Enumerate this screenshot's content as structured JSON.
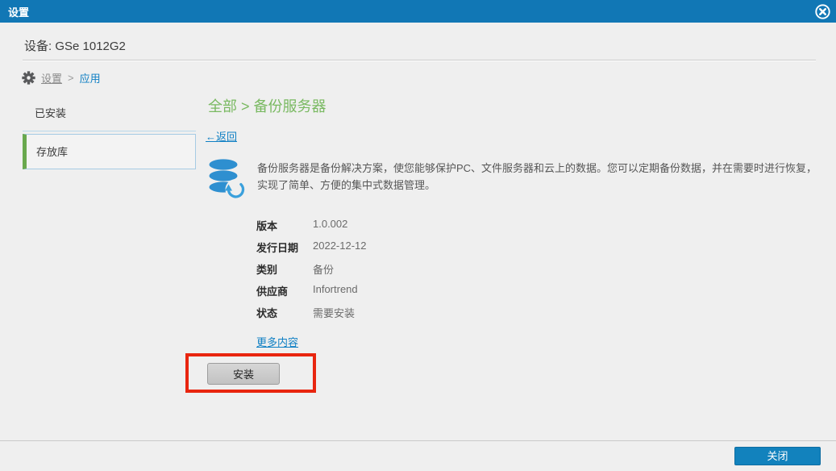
{
  "titlebar": {
    "title": "设置"
  },
  "device": {
    "title": "设备: GSe 1012G2"
  },
  "breadcrumb": {
    "root": "设置",
    "separator": ">",
    "current": "应用"
  },
  "sidebar": {
    "items": [
      {
        "label": "已安装",
        "selected": false
      },
      {
        "label": "存放库",
        "selected": true
      }
    ]
  },
  "main": {
    "heading": "全部 > 备份服务器",
    "back_link": "←返回",
    "app": {
      "icon": "database-sync-icon",
      "description_line1": "备份服务器是备份解决方案，使您能够保护PC、文件服务器和云上的数据。您可以定期备份数据，并在需要时进行恢复，",
      "description_line2": "实现了简单、方便的集中式数据管理。",
      "details": [
        {
          "label": "版本",
          "value": "1.0.002"
        },
        {
          "label": "发行日期",
          "value": "2022-12-12"
        },
        {
          "label": "类别",
          "value": "备份"
        },
        {
          "label": "供应商",
          "value": "Infortrend"
        },
        {
          "label": "状态",
          "value": "需要安装"
        }
      ],
      "more_link": "更多内容",
      "install_button": "安装"
    }
  },
  "footer": {
    "close_button": "关闭"
  },
  "colors": {
    "titlebar_blue": "#1177b5",
    "heading_green": "#79b961",
    "link_blue": "#1080c4",
    "selected_green_bar": "#69a84e",
    "selected_border_blue": "#a6cbe4",
    "annotation_red": "#e8250f",
    "close_button_blue": "#1282bd",
    "app_icon_blue": "#2e8fd0"
  }
}
